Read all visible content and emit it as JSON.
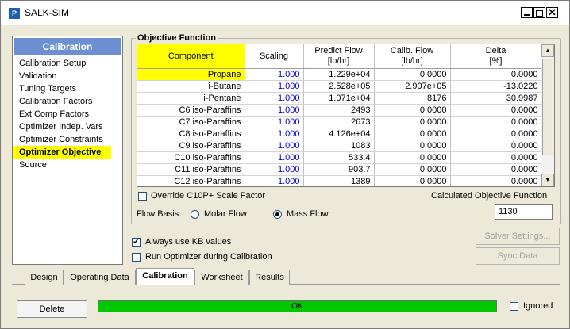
{
  "window": {
    "title": "SALK-SIM",
    "icon_name": "app-icon",
    "app_icon_letter": "P"
  },
  "sidebar": {
    "header": "Calibration",
    "items": [
      "Calibration Setup",
      "Validation",
      "Tuning Targets",
      "Calibration Factors",
      "Ext Comp Factors",
      "Optimizer Indep. Vars",
      "Optimizer Constraints",
      "Optimizer Objective",
      "Source"
    ],
    "active_index": 7
  },
  "objective": {
    "group_label": "Objective Function",
    "columns": {
      "component": "Component",
      "scaling": "Scaling",
      "predict": "Predict Flow",
      "predict_unit": "[lb/hr]",
      "calib": "Calib. Flow",
      "calib_unit": "[lb/hr]",
      "delta": "Delta",
      "delta_unit": "[%]"
    },
    "rows": [
      {
        "component": "Propane",
        "scaling": "1.000",
        "predict": "1.229e+04",
        "calib": "0.0000",
        "delta": "0.0000"
      },
      {
        "component": "i-Butane",
        "scaling": "1.000",
        "predict": "2.528e+05",
        "calib": "2.907e+05",
        "delta": "-13.0220"
      },
      {
        "component": "i-Pentane",
        "scaling": "1.000",
        "predict": "1.071e+04",
        "calib": "8176",
        "delta": "30.9987"
      },
      {
        "component": "C6 iso-Paraffins",
        "scaling": "1.000",
        "predict": "2493",
        "calib": "0.0000",
        "delta": "0.0000"
      },
      {
        "component": "C7 iso-Paraffins",
        "scaling": "1.000",
        "predict": "2673",
        "calib": "0.0000",
        "delta": "0.0000"
      },
      {
        "component": "C8 iso-Paraffins",
        "scaling": "1.000",
        "predict": "4.126e+04",
        "calib": "0.0000",
        "delta": "0.0000"
      },
      {
        "component": "C9 iso-Paraffins",
        "scaling": "1.000",
        "predict": "1083",
        "calib": "0.0000",
        "delta": "0.0000"
      },
      {
        "component": "C10 iso-Paraffins",
        "scaling": "1.000",
        "predict": "533.4",
        "calib": "0.0000",
        "delta": "0.0000"
      },
      {
        "component": "C11 iso-Paraffins",
        "scaling": "1.000",
        "predict": "903.7",
        "calib": "0.0000",
        "delta": "0.0000"
      },
      {
        "component": "C12 iso-Paraffins",
        "scaling": "1.000",
        "predict": "1389",
        "calib": "0.0000",
        "delta": "0.0000"
      }
    ],
    "override_label": "Override C10P+ Scale Factor",
    "override_checked": false,
    "calc_label": "Calculated Objective Function",
    "calc_value": "1130",
    "flow_basis_label": "Flow Basis:",
    "flow_basis_options": [
      "Molar Flow",
      "Mass Flow"
    ],
    "flow_basis_selected": "Mass Flow"
  },
  "options": {
    "always_kb_label": "Always use KB values",
    "always_kb_checked": true,
    "run_optimizer_label": "Run Optimizer during Calibration",
    "run_optimizer_checked": false
  },
  "buttons": {
    "solver_settings": "Solver Settings...",
    "sync_data": "Sync Data",
    "delete": "Delete"
  },
  "tabs": {
    "items": [
      "Design",
      "Operating Data",
      "Calibration",
      "Worksheet",
      "Results"
    ],
    "active": "Calibration"
  },
  "status": {
    "text": "OK",
    "color": "#00c800",
    "ignored_label": "Ignored",
    "ignored_checked": false
  },
  "colors": {
    "highlight": "#ffff00",
    "sidebar_header": "#6b8fd0",
    "scaling_text": "#0000cc"
  }
}
